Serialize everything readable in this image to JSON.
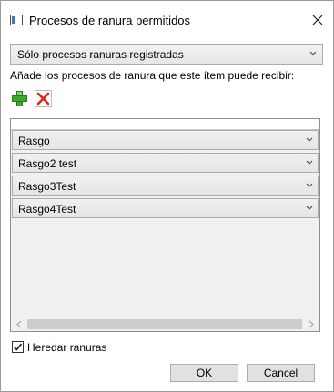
{
  "window": {
    "title": "Procesos de ranura permitidos",
    "app_icon": "window-icon",
    "close_icon": "close-icon"
  },
  "filter_dropdown": {
    "selected": "Sólo procesos ranuras registradas"
  },
  "instruction": "Añade los procesos de ranura que este ítem puede recibir:",
  "toolbar": {
    "add_icon": "plus-icon",
    "add_color": "#3fa52c",
    "delete_icon": "x-icon",
    "delete_color": "#d9261c"
  },
  "list": {
    "items": [
      {
        "label": "Rasgo"
      },
      {
        "label": "Rasgo2 test"
      },
      {
        "label": "Rasgo3Test"
      },
      {
        "label": "Rasgo4Test"
      }
    ]
  },
  "inherit": {
    "label": "Heredar ranuras",
    "checked": true
  },
  "buttons": {
    "ok": "OK",
    "cancel": "Cancel"
  }
}
